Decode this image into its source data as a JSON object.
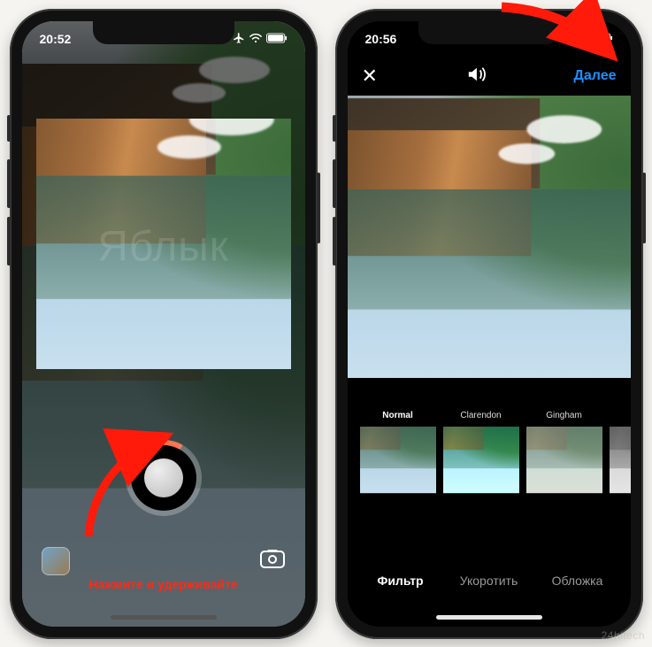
{
  "status": {
    "left_time": "20:52",
    "right_time": "20:56",
    "icons": {
      "airplane": "airplane-icon",
      "wifi": "wifi-icon",
      "battery": "battery-icon"
    }
  },
  "left_phone": {
    "watermark": "Яблык",
    "hint": "Нажмите и удерживайте",
    "gallery": "gallery-thumbnail",
    "switch_cam": "switch-camera-icon",
    "record": "record-button"
  },
  "right_phone": {
    "close": "✕",
    "sound": "sound-icon",
    "next": "Далее",
    "filters": [
      {
        "label": "Normal",
        "selected": true
      },
      {
        "label": "Clarendon",
        "selected": false
      },
      {
        "label": "Gingham",
        "selected": false
      },
      {
        "label": "",
        "selected": false
      }
    ],
    "tabs": {
      "filter": "Фильтр",
      "trim": "Укоротить",
      "cover": "Обложка"
    }
  },
  "site_watermark": "24hitech"
}
